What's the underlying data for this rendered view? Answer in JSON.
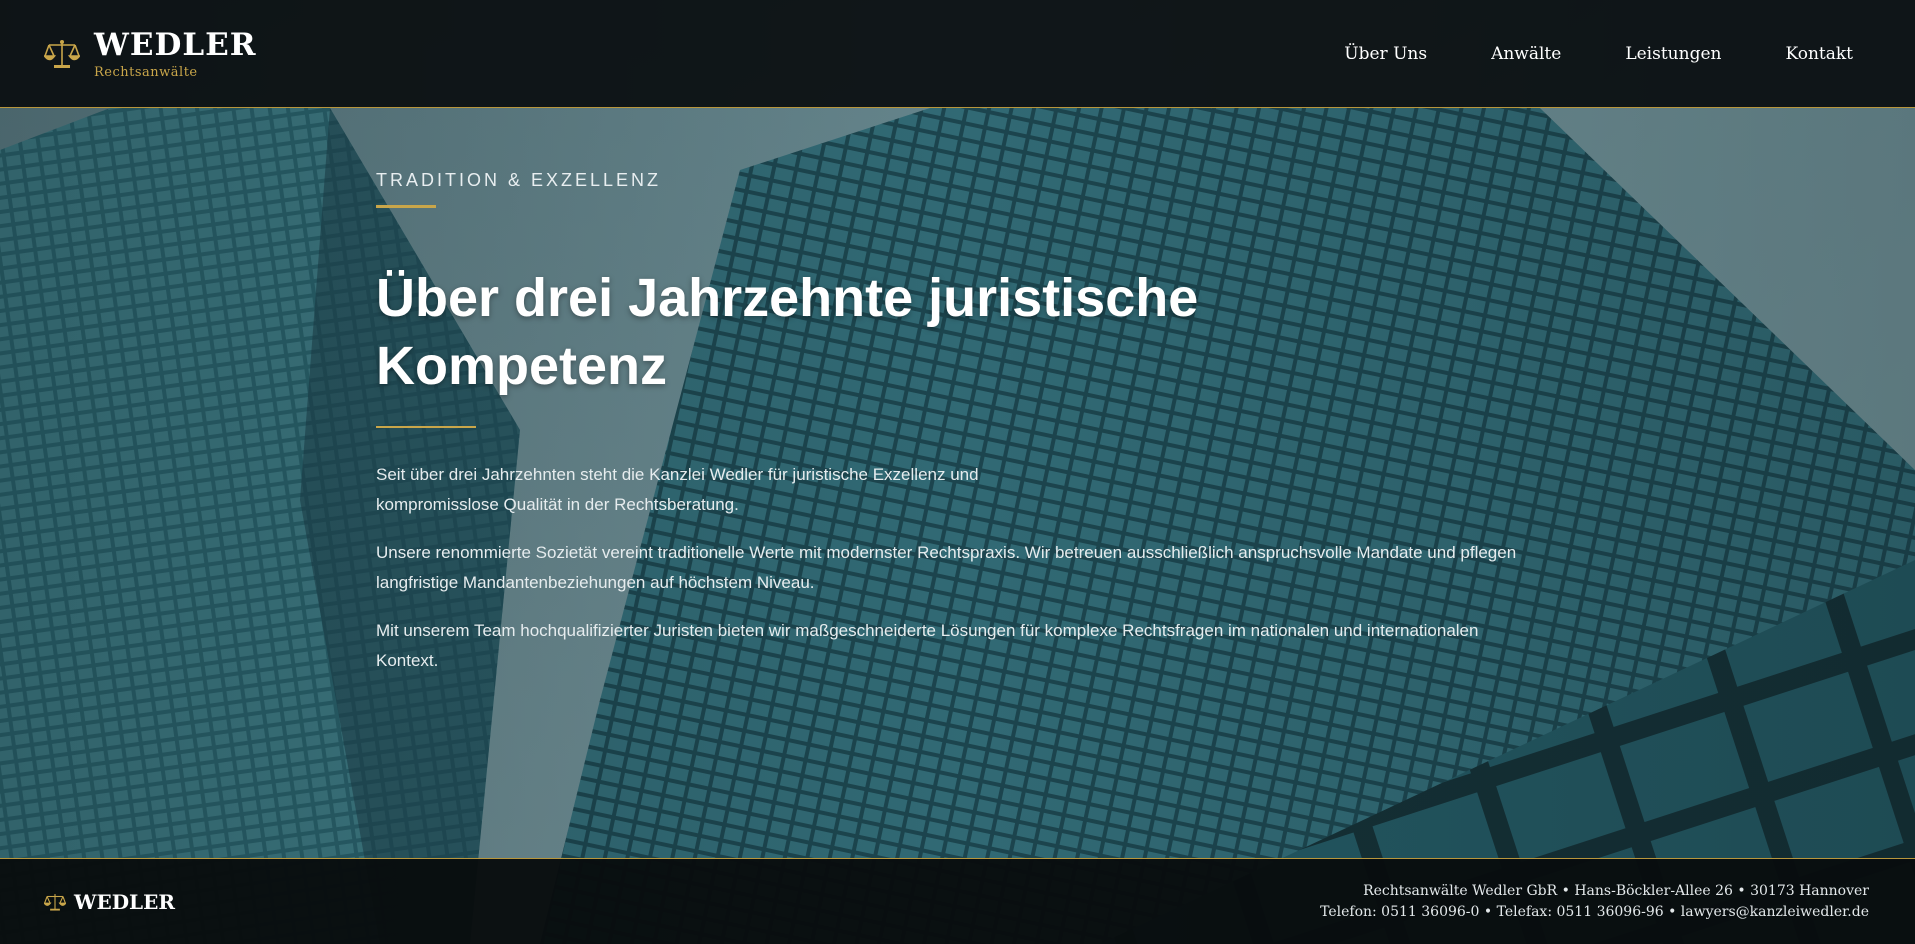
{
  "colors": {
    "accent": "#c9a64a",
    "header_bg": "#0b0f11",
    "hero_tint": "#2b5560"
  },
  "header": {
    "brand_name": "WEDLER",
    "brand_sub": "Rechtsanwälte",
    "logo_icon": "scales-icon",
    "nav": [
      {
        "label": "Über Uns"
      },
      {
        "label": "Anwälte"
      },
      {
        "label": "Leistungen"
      },
      {
        "label": "Kontakt"
      }
    ]
  },
  "hero": {
    "kicker": "TRADITION & EXZELLENZ",
    "headline_1": "Über drei Jahrzehnte juristische",
    "headline_2": "Kompetenz",
    "paragraphs": [
      "Seit über drei Jahrzehnten steht die Kanzlei Wedler für juristische Exzellenz und kompromisslose Qualität in der Rechtsberatung.",
      "Unsere renommierte Sozietät vereint traditionelle Werte mit modernster Rechtspraxis. Wir betreuen ausschließlich anspruchsvolle Mandate und pflegen langfristige Mandantenbeziehungen auf höchstem Niveau.",
      "Mit unserem Team hochqualifizierter Juristen bieten wir maßgeschneiderte Lösungen für komplexe Rechtsfragen im nationalen und internationalen Kontext."
    ]
  },
  "footer": {
    "brand_name": "WEDLER",
    "address_line": "Rechtsanwälte Wedler GbR • Hans-Böckler-Allee 26 • 30173 Hannover",
    "contact_line": "Telefon: 0511 36096-0 • Telefax: 0511 36096-96 • lawyers@kanzleiwedler.de"
  }
}
